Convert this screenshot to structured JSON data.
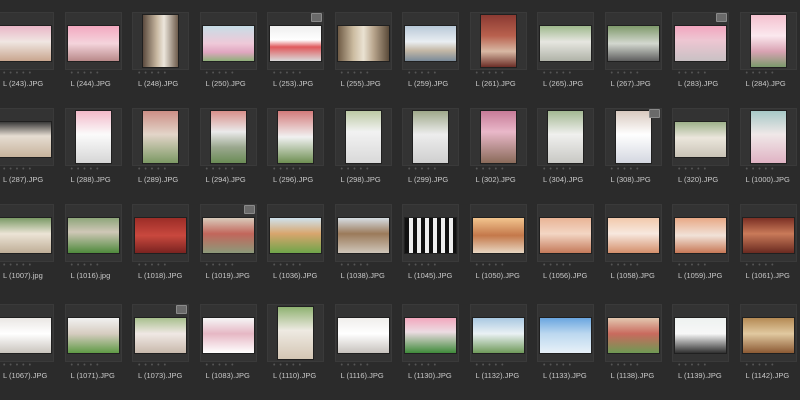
{
  "files": [
    [
      {
        "name": "L (243).JPG",
        "orient": "land",
        "bg": "linear-gradient(180deg,#e9b7c7 0%,#f0e6e2 45%,#c9a68f 100%)"
      },
      {
        "name": "L (244).JPG",
        "orient": "land",
        "bg": "linear-gradient(180deg,#f3a9c0 0%,#f4d4dc 50%,#b98a8a 100%)"
      },
      {
        "name": "L (248).JPG",
        "orient": "port",
        "bg": "linear-gradient(90deg,#5b4a3e 0%,#c9b9a2 40%,#ece6dc 60%,#6e5c4c 100%)"
      },
      {
        "name": "L (250).JPG",
        "orient": "land",
        "bg": "linear-gradient(180deg,#c7dde6 0%,#efc9d8 50%,#e0a6c0 75%,#8fb07a 100%)"
      },
      {
        "name": "L (253).JPG",
        "orient": "land",
        "bg": "linear-gradient(180deg,#efefef 0%,#ffffff 40%,#e0595b 60%,#d9d9d9 100%)",
        "badge": true
      },
      {
        "name": "L (255).JPG",
        "orient": "land",
        "bg": "linear-gradient(90deg,#6f5b45 0%,#cbbba0 30%,#eae2d2 50%,#b8a58c 70%,#5a4a39 100%)"
      },
      {
        "name": "L (259).JPG",
        "orient": "land",
        "bg": "linear-gradient(180deg,#b9c9d8 0%,#e9eef2 45%,#c4b8a6 70%,#7a8b9a 100%)"
      },
      {
        "name": "L (261).JPG",
        "orient": "port",
        "bg": "linear-gradient(180deg,#8b3a32 0%,#b9614e 40%,#d8b8a4 70%,#6b2e27 100%)"
      },
      {
        "name": "L (265).JPG",
        "orient": "land",
        "bg": "linear-gradient(180deg,#9fb98d 0%,#e6e6e0 45%,#b0b3a8 100%)"
      },
      {
        "name": "L (267).JPG",
        "orient": "land",
        "bg": "linear-gradient(180deg,#7f9a6b 0%,#d3d8cf 50%,#5f5f5f 100%)"
      },
      {
        "name": "L (283).JPG",
        "orient": "land",
        "bg": "linear-gradient(180deg,#f2a6bf 0%,#eec6d2 40%,#c9c1c4 100%)",
        "badge": true
      },
      {
        "name": "L (284).JPG",
        "orient": "port",
        "bg": "linear-gradient(180deg,#f4c1cf 0%,#fbe8ee 40%,#d9a3b3 70%,#7b9a6c 100%)"
      }
    ],
    [
      {
        "name": "L (287).JPG",
        "orient": "land",
        "bg": "linear-gradient(180deg,#3a3a3a 0%,#e6ddd2 40%,#c7b39c 100%)"
      },
      {
        "name": "L (288).JPG",
        "orient": "port",
        "bg": "linear-gradient(180deg,#f2b9c9 0%,#fbfbfb 45%,#d6d6d6 100%)"
      },
      {
        "name": "L (289).JPG",
        "orient": "port",
        "bg": "linear-gradient(180deg,#cc8f86 0%,#e3d5c9 45%,#7c9964 100%)"
      },
      {
        "name": "L (294).JPG",
        "orient": "port",
        "bg": "linear-gradient(180deg,#d88f8a 0%,#eaeaea 40%,#9aa78e 70%,#6a8c55 100%)"
      },
      {
        "name": "L (296).JPG",
        "orient": "port",
        "bg": "linear-gradient(180deg,#d37a7a 0%,#f1f1f1 50%,#6f8f52 100%)"
      },
      {
        "name": "L (298).JPG",
        "orient": "port",
        "bg": "linear-gradient(180deg,#bcc9a4 0%,#f2f2f2 40%,#d9d9d9 100%)"
      },
      {
        "name": "L (299).JPG",
        "orient": "port",
        "bg": "linear-gradient(180deg,#9fa98a 0%,#ededed 45%,#cfcfcf 100%)"
      },
      {
        "name": "L (302).JPG",
        "orient": "port",
        "bg": "linear-gradient(180deg,#c77b98 0%,#e9b8c9 40%,#8a6b5a 100%)"
      },
      {
        "name": "L (304).JPG",
        "orient": "port",
        "bg": "linear-gradient(180deg,#a3b892 0%,#f0f0ee 45%,#c8c8c4 100%)"
      },
      {
        "name": "L (308).JPG",
        "orient": "port",
        "bg": "linear-gradient(180deg,#d8c9bf 0%,#ffffff 45%,#d4d7e0 100%)",
        "badge": true
      },
      {
        "name": "L (320).JPG",
        "orient": "land",
        "bg": "linear-gradient(180deg,#9db18a 0%,#ebe6dc 45%,#c9c3b6 100%)"
      },
      {
        "name": "L (1000).JPG",
        "orient": "port",
        "bg": "linear-gradient(180deg,#a6c8c6 0%,#f0e8e8 45%,#e0b3c4 100%)"
      }
    ],
    [
      {
        "name": "L (1007).jpg",
        "orient": "land",
        "bg": "linear-gradient(180deg,#7b9a66 0%,#ece4d6 45%,#bfae97 100%)"
      },
      {
        "name": "L (1016).jpg",
        "orient": "land",
        "bg": "linear-gradient(180deg,#8ea67a 0%,#cfc7b7 40%,#4f8a3c 100%)"
      },
      {
        "name": "L (1018).JPG",
        "orient": "land",
        "bg": "linear-gradient(180deg,#9c2d27 0%,#c9483e 50%,#7a2320 100%)"
      },
      {
        "name": "L (1019).JPG",
        "orient": "land",
        "bg": "linear-gradient(180deg,#d9cbbb 0%,#c2665b 45%,#8c9a7a 100%)",
        "badge": true
      },
      {
        "name": "L (1036).JPG",
        "orient": "land",
        "bg": "linear-gradient(180deg,#cfe2ec 0%,#d8a56d 45%,#6fa54a 100%)"
      },
      {
        "name": "L (1038).JPG",
        "orient": "land",
        "bg": "linear-gradient(180deg,#d6dde3 0%,#9b7a5a 45%,#cfc6b9 100%)"
      },
      {
        "name": "L (1045).JPG",
        "orient": "land",
        "bg": "repeating-linear-gradient(90deg,#111 0px,#111 4px,#eee 4px,#eee 8px)"
      },
      {
        "name": "L (1050).JPG",
        "orient": "land",
        "bg": "linear-gradient(180deg,#f2c58f 0%,#c4784a 50%,#e8d6c2 100%)"
      },
      {
        "name": "L (1056).JPG",
        "orient": "land",
        "bg": "linear-gradient(180deg,#e9b496 0%,#f3d6c4 45%,#c47a5a 100%)"
      },
      {
        "name": "L (1058).JPG",
        "orient": "land",
        "bg": "linear-gradient(180deg,#f2c9ac 0%,#f7e8df 45%,#d48f6b 100%)"
      },
      {
        "name": "L (1059).JPG",
        "orient": "land",
        "bg": "linear-gradient(180deg,#e8a986 0%,#f1e2d8 50%,#c77856 100%)"
      },
      {
        "name": "L (1061).JPG",
        "orient": "land",
        "bg": "linear-gradient(180deg,#7b2f24 0%,#c97a59 45%,#6a2a20 100%)"
      }
    ],
    [
      {
        "name": "L (1067).JPG",
        "orient": "land",
        "bg": "linear-gradient(180deg,#eae7e4 0%,#ffffff 45%,#c9c4bd 100%)"
      },
      {
        "name": "L (1071).JPG",
        "orient": "land",
        "bg": "linear-gradient(180deg,#f1f1f1 0%,#d6ccc0 45%,#5f9a45 100%)"
      },
      {
        "name": "L (1073).JPG",
        "orient": "land",
        "bg": "linear-gradient(180deg,#a8c08e 0%,#f0e8e4 45%,#c8b9ac 100%)",
        "badge": true
      },
      {
        "name": "L (1083).JPG",
        "orient": "land",
        "bg": "linear-gradient(180deg,#f6f6f6 0%,#e6b7c4 45%,#ffffff 100%)"
      },
      {
        "name": "L (1110).JPG",
        "orient": "port",
        "bg": "linear-gradient(180deg,#8fb271 0%,#eeeae2 45%,#d4c6b4 100%)"
      },
      {
        "name": "L (1116).JPG",
        "orient": "land",
        "bg": "linear-gradient(180deg,#f0eeec 0%,#ffffff 45%,#c7c2bd 100%)"
      },
      {
        "name": "L (1130).JPG",
        "orient": "land",
        "bg": "linear-gradient(180deg,#f2a8be 0%,#ecdce2 40%,#3f8a3a 100%)"
      },
      {
        "name": "L (1132).JPG",
        "orient": "land",
        "bg": "linear-gradient(180deg,#aac9e2 0%,#eaf1f4 45%,#6f9a5a 100%)"
      },
      {
        "name": "L (1133).JPG",
        "orient": "land",
        "bg": "linear-gradient(180deg,#6aa6e0 0%,#bcd8ef 45%,#e8f1f8 100%)"
      },
      {
        "name": "L (1138).JPG",
        "orient": "land",
        "bg": "linear-gradient(180deg,#e3c8b0 0%,#c96a5e 45%,#6f9a54 100%)"
      },
      {
        "name": "L (1139).JPG",
        "orient": "land",
        "bg": "linear-gradient(180deg,#eef2f0 0%,#f7f7f7 45%,#2f2f2f 100%)"
      },
      {
        "name": "L (1142).JPG",
        "orient": "land",
        "bg": "linear-gradient(180deg,#b58a54 0%,#e1c9a0 45%,#8c5a34 100%)"
      }
    ]
  ]
}
